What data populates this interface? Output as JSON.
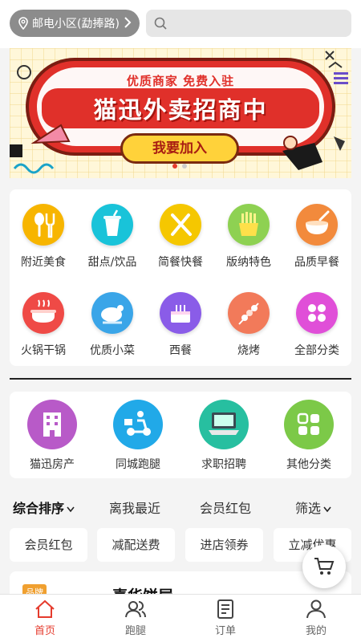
{
  "location": {
    "label": "邮电小区(勐捧路)"
  },
  "search": {
    "placeholder": ""
  },
  "banner": {
    "subtitle": "优质商家 免费入驻",
    "title": "猫迅外卖招商中",
    "button_label": "我要加入",
    "slide_count": 2,
    "active_slide": 1
  },
  "categories": [
    {
      "label": "附近美食",
      "icon": "spoon-fork-icon",
      "color": "#f7b500"
    },
    {
      "label": "甜点/饮品",
      "icon": "drink-cup-icon",
      "color": "#19c3d9"
    },
    {
      "label": "简餐快餐",
      "icon": "knife-fork-icon",
      "color": "#f5c700"
    },
    {
      "label": "版纳特色",
      "icon": "fries-icon",
      "color": "#8ed152"
    },
    {
      "label": "品质早餐",
      "icon": "bowl-icon",
      "color": "#f28a3c"
    },
    {
      "label": "火锅干锅",
      "icon": "hotpot-icon",
      "color": "#ef4a46"
    },
    {
      "label": "优质小菜",
      "icon": "chicken-icon",
      "color": "#3aa5e8"
    },
    {
      "label": "西餐",
      "icon": "cake-icon",
      "color": "#8a5ce8"
    },
    {
      "label": "烧烤",
      "icon": "skewer-icon",
      "color": "#f27a5a"
    },
    {
      "label": "全部分类",
      "icon": "grid-icon",
      "color": "#e04fd8"
    }
  ],
  "services": [
    {
      "label": "猫迅房产",
      "icon": "building-icon",
      "color": "#b85ac8"
    },
    {
      "label": "同城跑腿",
      "icon": "delivery-scooter-icon",
      "color": "#21a9e8"
    },
    {
      "label": "求职招聘",
      "icon": "laptop-icon",
      "color": "#27bfa0"
    },
    {
      "label": "其他分类",
      "icon": "apps-icon",
      "color": "#7cc948"
    }
  ],
  "sort_options": [
    {
      "label": "综合排序",
      "active": true,
      "has_arrow": true
    },
    {
      "label": "离我最近",
      "active": false,
      "has_arrow": false
    },
    {
      "label": "会员红包",
      "active": false,
      "has_arrow": false
    },
    {
      "label": "筛选",
      "active": false,
      "has_arrow": true
    }
  ],
  "filter_chips": [
    "会员红包",
    "减配送费",
    "进店领券",
    "立减优惠"
  ],
  "store_preview": {
    "badge": "品牌",
    "name": "喜华饼屋"
  },
  "tabs": [
    {
      "label": "首页",
      "icon": "home-icon",
      "active": true
    },
    {
      "label": "跑腿",
      "icon": "users-icon",
      "active": false
    },
    {
      "label": "订单",
      "icon": "order-icon",
      "active": false
    },
    {
      "label": "我的",
      "icon": "profile-icon",
      "active": false
    }
  ],
  "colors": {
    "accent": "#e53b2d",
    "banner_red": "#e0302a",
    "banner_yellow": "#ffd23a"
  }
}
